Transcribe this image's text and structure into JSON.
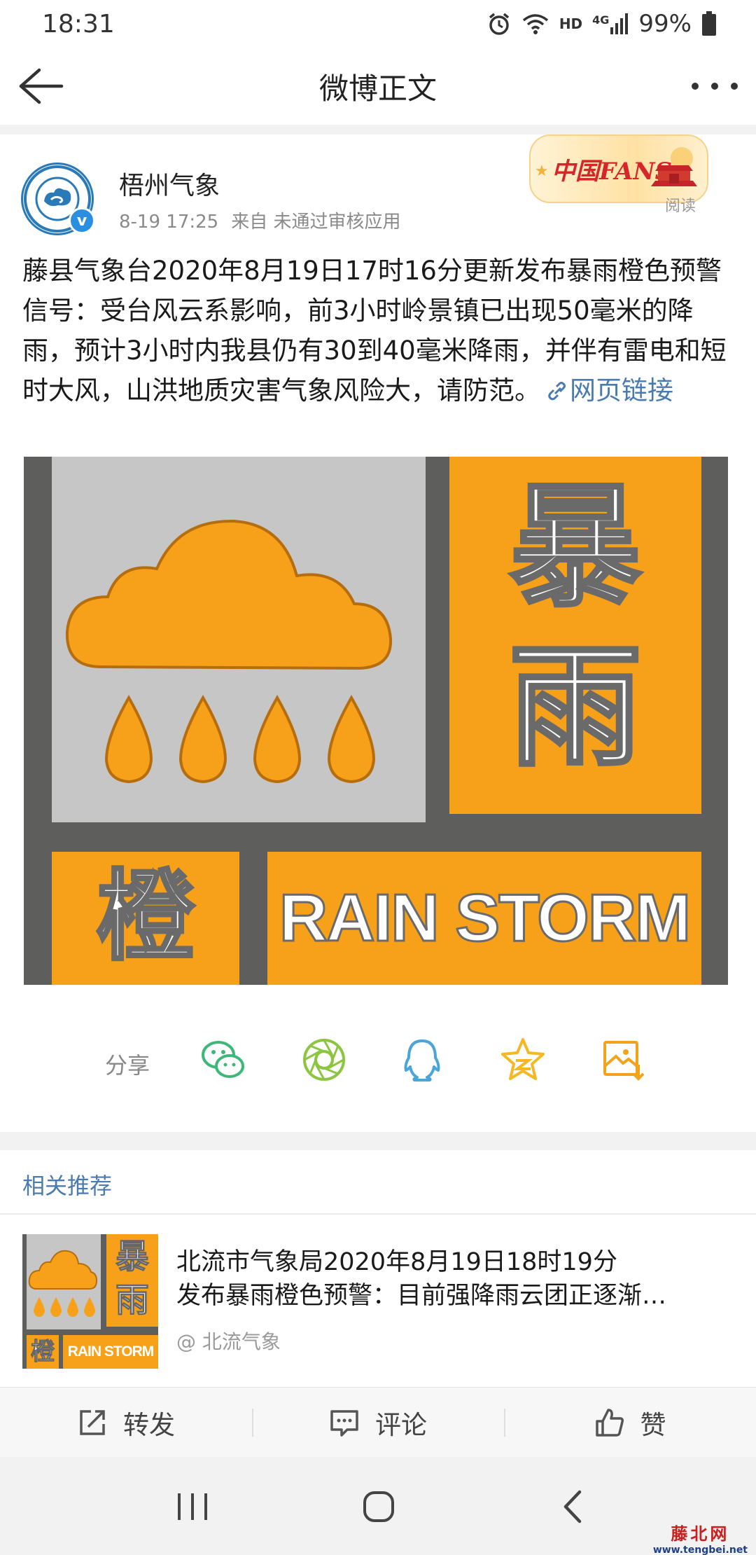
{
  "status_bar": {
    "time": "18:31",
    "hd": "HD",
    "network": "4G",
    "battery": "99%"
  },
  "nav": {
    "title": "微博正文"
  },
  "post": {
    "author": "梧州气象",
    "avatar_caption": "梧州气象",
    "verified_mark": "v",
    "time": "8-19 17:25",
    "source": "来自 未通过审核应用",
    "fans_badge": "中国FANS",
    "read_label": "阅读",
    "text": "藤县气象台2020年8月19日17时16分更新发布暴雨橙色预警信号：受台风云系影响，前3小时岭景镇已出现50毫米的降雨，预计3小时内我县仍有30到40毫米降雨，并伴有雷电和短时大风，山洪地质灾害气象风险大，请防范。",
    "link_text": "网页链接",
    "image": {
      "char_top": "暴",
      "char_mid": "雨",
      "char_color": "橙",
      "english": "RAIN STORM",
      "colors": {
        "orange": "#f7a11a",
        "gray": "#c6c6c6",
        "dark": "#5e5e5d",
        "outline": "#b66d0e"
      }
    }
  },
  "share": {
    "label": "分享",
    "icons": [
      "wechat-icon",
      "moments-icon",
      "qq-icon",
      "qzone-icon",
      "save-image-icon"
    ]
  },
  "related": {
    "title": "相关推荐",
    "item": {
      "line1": "北流市气象局2020年8月19日18时19分",
      "line2": "发布暴雨橙色预警：目前强降雨云团正逐渐…",
      "author": "@ 北流气象"
    }
  },
  "actions": {
    "repost": "转发",
    "comment": "评论",
    "like": "赞"
  },
  "watermark": {
    "cn": "藤北网",
    "en": "www.tengbei.net"
  }
}
